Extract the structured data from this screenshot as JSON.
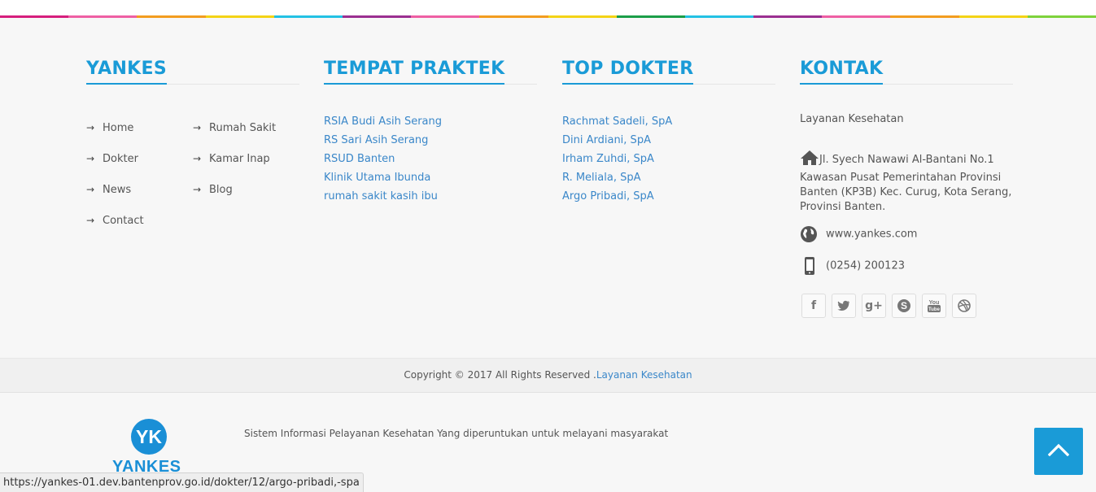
{
  "colors": {
    "accent": "#1a9bd7",
    "link": "#3a87c9",
    "rainbow": [
      "#d61e7d",
      "#ee5fa3",
      "#f39d1f",
      "#f4d316",
      "#23c1e4",
      "#9b2f90",
      "#ee5fa3",
      "#f39d1f",
      "#f4d316",
      "#1b9e48",
      "#23c1e4",
      "#9b2f90",
      "#ee5fa3",
      "#f39d1f",
      "#f4d316",
      "#7ed23b"
    ]
  },
  "columns": {
    "yankes": {
      "title": "YANKES",
      "items": [
        {
          "label": "Home"
        },
        {
          "label": "Rumah Sakit"
        },
        {
          "label": "Dokter"
        },
        {
          "label": "Kamar Inap"
        },
        {
          "label": "News"
        },
        {
          "label": "Blog"
        },
        {
          "label": "Contact"
        }
      ]
    },
    "tempat_praktek": {
      "title": "TEMPAT PRAKTEK",
      "links": [
        "RSIA Budi Asih Serang",
        "RS Sari Asih Serang",
        "RSUD Banten",
        "Klinik Utama Ibunda",
        "rumah sakit kasih ibu"
      ]
    },
    "top_dokter": {
      "title": "TOP DOKTER",
      "links": [
        "Rachmat Sadeli, SpA",
        "Dini Ardiani, SpA",
        "Irham Zuhdi, SpA",
        "R. Meliala, SpA",
        "Argo Pribadi, SpA"
      ]
    },
    "kontak": {
      "title": "KONTAK",
      "subtitle": "Layanan Kesehatan",
      "address": "Jl. Syech Nawawi Al-Bantani No.1 Kawasan Pusat Pemerintahan Provinsi Banten (KP3B) Kec. Curug, Kota Serang, Provinsi Banten.",
      "website": "www.yankes.com",
      "phone": "(0254) 200123",
      "social": [
        "facebook-icon",
        "twitter-icon",
        "google-plus-icon",
        "skype-icon",
        "youtube-icon",
        "dribbble-icon"
      ]
    }
  },
  "copyright": {
    "text": "Copyright © 2017 All Rights Reserved .",
    "link": "Layanan Kesehatan"
  },
  "logo": {
    "initials": "YK",
    "name": "YANKES"
  },
  "description": "Sistem Informasi Pelayanan Kesehatan Yang diperuntukan untuk melayani masyarakat",
  "status_url": "https://yankes-01.dev.bantenprov.go.id/dokter/12/argo-pribadi,-spa"
}
